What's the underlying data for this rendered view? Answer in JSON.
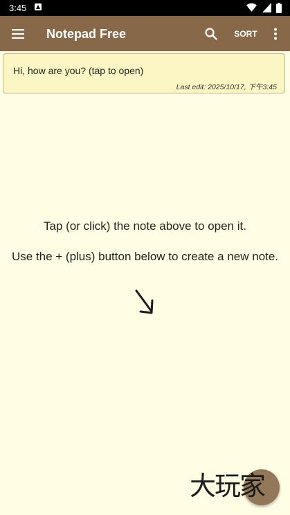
{
  "status_bar": {
    "time": "3:45",
    "notification_icon": "a-notification-icon",
    "icons": [
      "wifi-icon",
      "cell-signal-icon",
      "battery-icon"
    ]
  },
  "app_bar": {
    "title": "Notepad Free",
    "sort_label": "SORT",
    "background": "#87694a",
    "icons": [
      "menu-icon",
      "search-icon",
      "more-vert-icon"
    ]
  },
  "notes": [
    {
      "text": "Hi, how are you? (tap to open)",
      "last_edit": "Last edit: 2025/10/17, 下午3:45"
    }
  ],
  "hints": {
    "open_note": "Tap (or click) the note above to open it.",
    "create_note": "Use the + (plus) button below to create a new note."
  },
  "watermark": {
    "text": "大玩家"
  },
  "colors": {
    "background": "#fffde4",
    "note_card": "#fcf6c4",
    "accent": "#87694a"
  }
}
